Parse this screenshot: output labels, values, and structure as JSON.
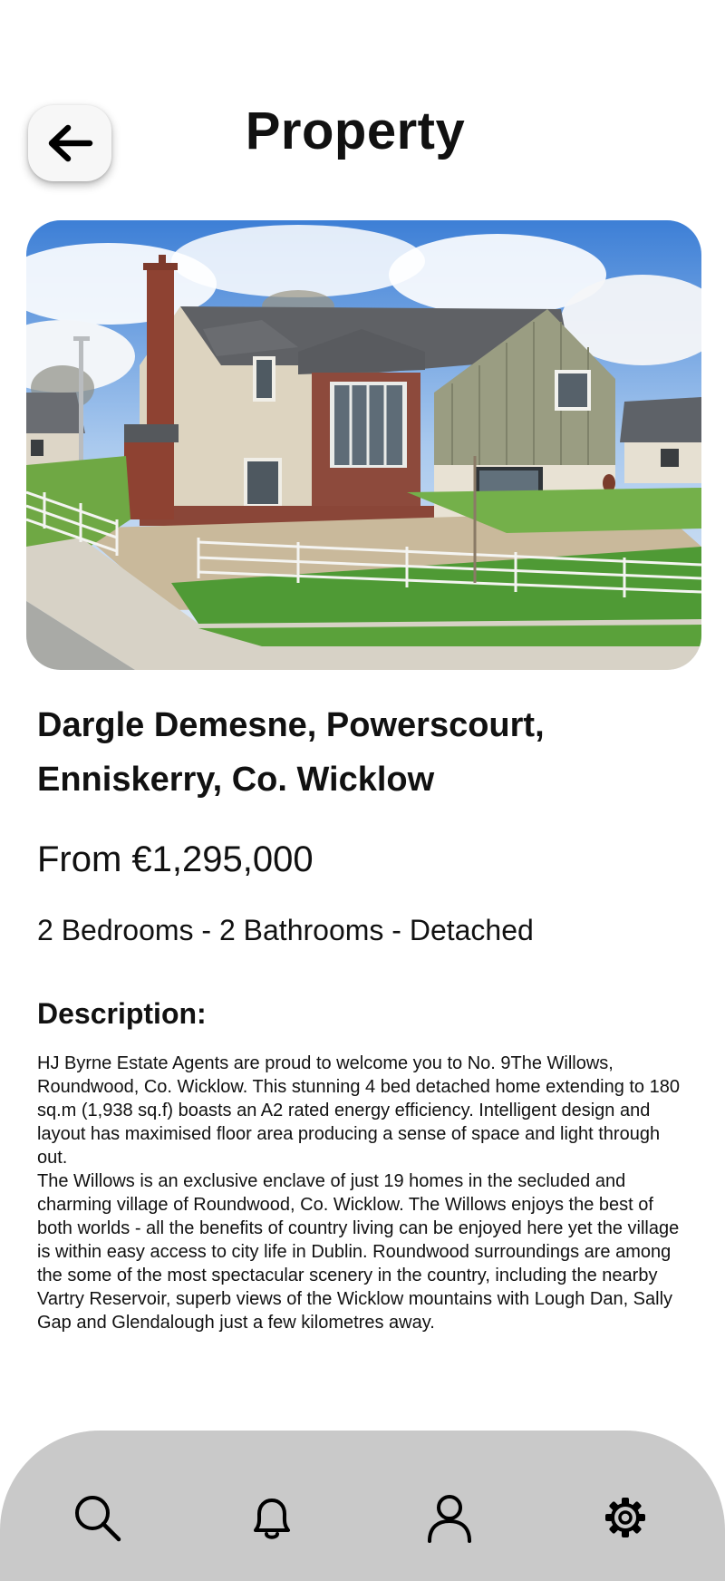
{
  "header": {
    "title": "Property",
    "back_icon": "arrow-left-icon"
  },
  "property": {
    "image_alt": "Detached two-storey house with brick chimney, white fence and lawn",
    "address": "Dargle Demesne, Powerscourt, Enniskerry, Co. Wicklow",
    "price": "From €1,295,000",
    "specs": "2 Bedrooms - 2 Bathrooms - Detached"
  },
  "description": {
    "heading": "Description:",
    "paragraphs": [
      "HJ Byrne Estate Agents are proud to welcome you to No. 9The Willows, Roundwood, Co. Wicklow. This stunning 4 bed detached home extending to 180 sq.m (1,938 sq.f) boasts an A2 rated energy efficiency. Intelligent design and layout has maximised floor area producing a sense of space and light through out.",
      "The Willows is an exclusive enclave of just 19 homes in the secluded and charming village of Roundwood, Co. Wicklow. The Willows enjoys the best of both worlds - all the benefits of country living can be enjoyed here yet the village is within easy access to city life in Dublin. Roundwood surroundings are among the some of the most spectacular scenery in the country, including the nearby Vartry Reservoir, superb views of the Wicklow mountains with Lough Dan, Sally Gap and Glendalough just a few kilometres away."
    ]
  },
  "bottom_nav": {
    "items": [
      {
        "icon": "search-icon"
      },
      {
        "icon": "bell-icon"
      },
      {
        "icon": "user-icon"
      },
      {
        "icon": "gear-icon"
      }
    ],
    "background": "#c9c9c9"
  },
  "colors": {
    "text": "#111111",
    "page_background": "#ffffff",
    "back_button": "#f7f7f7"
  }
}
